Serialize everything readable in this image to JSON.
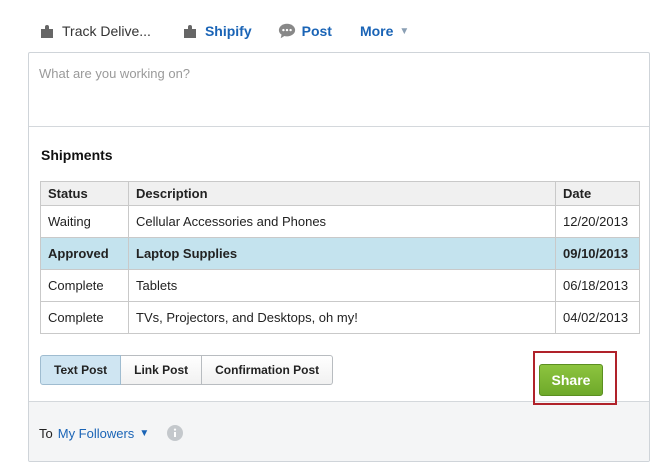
{
  "tabs": [
    {
      "label": "Track Delive...",
      "icon": "puzzle-piece-icon"
    },
    {
      "label": "Shipify",
      "icon": "puzzle-piece-icon"
    },
    {
      "label": "Post",
      "icon": "speech-bubble-icon"
    },
    {
      "label": "More",
      "icon": "caret-down-icon"
    }
  ],
  "composer": {
    "placeholder": "What are you working on?"
  },
  "shipments": {
    "title": "Shipments",
    "columns": [
      "Status",
      "Description",
      "Date"
    ],
    "rows": [
      {
        "status": "Waiting",
        "description": "Cellular Accessories and Phones",
        "date": "12/20/2013",
        "selected": false
      },
      {
        "status": "Approved",
        "description": "Laptop Supplies",
        "date": "09/10/2013",
        "selected": true
      },
      {
        "status": "Complete",
        "description": "Tablets",
        "date": "06/18/2013",
        "selected": false
      },
      {
        "status": "Complete",
        "description": "TVs, Projectors, and Desktops, oh my!",
        "date": "04/02/2013",
        "selected": false
      }
    ]
  },
  "post_types": [
    {
      "label": "Text Post",
      "active": true
    },
    {
      "label": "Link Post",
      "active": false
    },
    {
      "label": "Confirmation Post",
      "active": false
    }
  ],
  "footer": {
    "to_label": "To",
    "audience": "My Followers",
    "share_label": "Share"
  },
  "colors": {
    "link": "#1a64b6",
    "selected_row": "#c4e3ee",
    "share_button": "#7ab535",
    "highlight_frame": "#b0222a"
  }
}
